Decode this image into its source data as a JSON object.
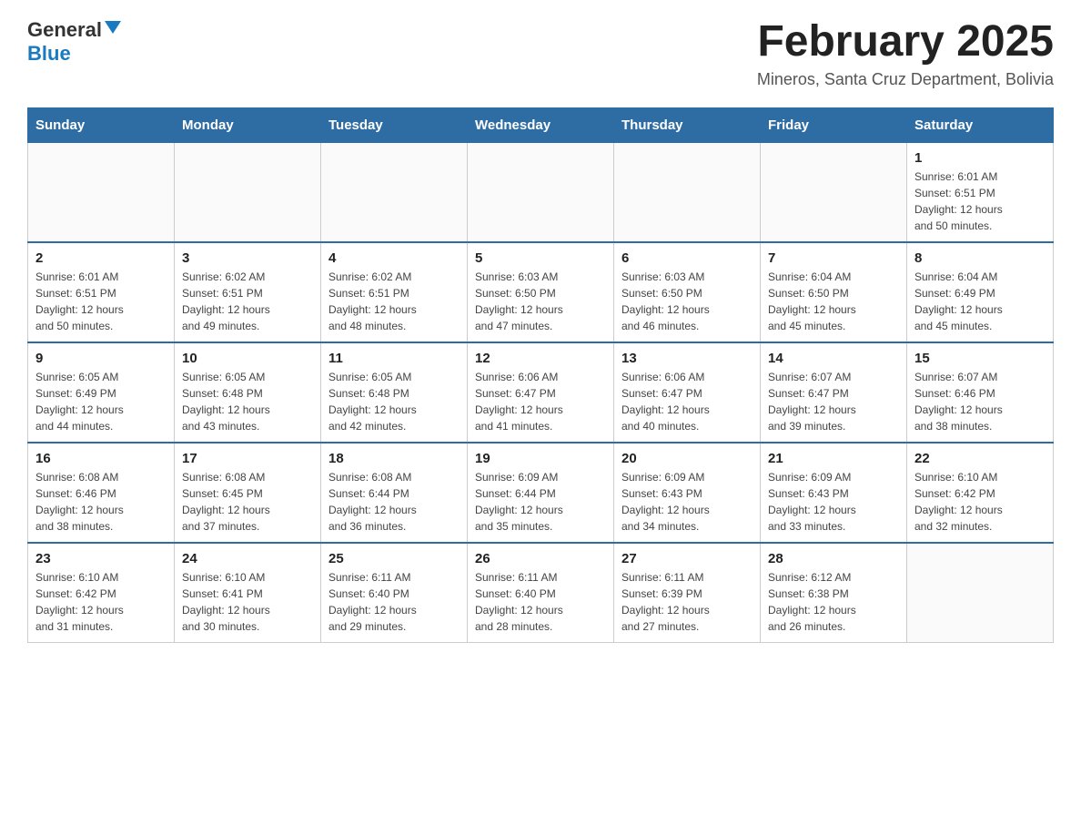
{
  "header": {
    "logo": {
      "general": "General",
      "blue": "Blue",
      "triangle": "▲"
    },
    "title": "February 2025",
    "location": "Mineros, Santa Cruz Department, Bolivia"
  },
  "weekdays": [
    "Sunday",
    "Monday",
    "Tuesday",
    "Wednesday",
    "Thursday",
    "Friday",
    "Saturday"
  ],
  "weeks": [
    [
      {
        "day": "",
        "info": ""
      },
      {
        "day": "",
        "info": ""
      },
      {
        "day": "",
        "info": ""
      },
      {
        "day": "",
        "info": ""
      },
      {
        "day": "",
        "info": ""
      },
      {
        "day": "",
        "info": ""
      },
      {
        "day": "1",
        "info": "Sunrise: 6:01 AM\nSunset: 6:51 PM\nDaylight: 12 hours\nand 50 minutes."
      }
    ],
    [
      {
        "day": "2",
        "info": "Sunrise: 6:01 AM\nSunset: 6:51 PM\nDaylight: 12 hours\nand 50 minutes."
      },
      {
        "day": "3",
        "info": "Sunrise: 6:02 AM\nSunset: 6:51 PM\nDaylight: 12 hours\nand 49 minutes."
      },
      {
        "day": "4",
        "info": "Sunrise: 6:02 AM\nSunset: 6:51 PM\nDaylight: 12 hours\nand 48 minutes."
      },
      {
        "day": "5",
        "info": "Sunrise: 6:03 AM\nSunset: 6:50 PM\nDaylight: 12 hours\nand 47 minutes."
      },
      {
        "day": "6",
        "info": "Sunrise: 6:03 AM\nSunset: 6:50 PM\nDaylight: 12 hours\nand 46 minutes."
      },
      {
        "day": "7",
        "info": "Sunrise: 6:04 AM\nSunset: 6:50 PM\nDaylight: 12 hours\nand 45 minutes."
      },
      {
        "day": "8",
        "info": "Sunrise: 6:04 AM\nSunset: 6:49 PM\nDaylight: 12 hours\nand 45 minutes."
      }
    ],
    [
      {
        "day": "9",
        "info": "Sunrise: 6:05 AM\nSunset: 6:49 PM\nDaylight: 12 hours\nand 44 minutes."
      },
      {
        "day": "10",
        "info": "Sunrise: 6:05 AM\nSunset: 6:48 PM\nDaylight: 12 hours\nand 43 minutes."
      },
      {
        "day": "11",
        "info": "Sunrise: 6:05 AM\nSunset: 6:48 PM\nDaylight: 12 hours\nand 42 minutes."
      },
      {
        "day": "12",
        "info": "Sunrise: 6:06 AM\nSunset: 6:47 PM\nDaylight: 12 hours\nand 41 minutes."
      },
      {
        "day": "13",
        "info": "Sunrise: 6:06 AM\nSunset: 6:47 PM\nDaylight: 12 hours\nand 40 minutes."
      },
      {
        "day": "14",
        "info": "Sunrise: 6:07 AM\nSunset: 6:47 PM\nDaylight: 12 hours\nand 39 minutes."
      },
      {
        "day": "15",
        "info": "Sunrise: 6:07 AM\nSunset: 6:46 PM\nDaylight: 12 hours\nand 38 minutes."
      }
    ],
    [
      {
        "day": "16",
        "info": "Sunrise: 6:08 AM\nSunset: 6:46 PM\nDaylight: 12 hours\nand 38 minutes."
      },
      {
        "day": "17",
        "info": "Sunrise: 6:08 AM\nSunset: 6:45 PM\nDaylight: 12 hours\nand 37 minutes."
      },
      {
        "day": "18",
        "info": "Sunrise: 6:08 AM\nSunset: 6:44 PM\nDaylight: 12 hours\nand 36 minutes."
      },
      {
        "day": "19",
        "info": "Sunrise: 6:09 AM\nSunset: 6:44 PM\nDaylight: 12 hours\nand 35 minutes."
      },
      {
        "day": "20",
        "info": "Sunrise: 6:09 AM\nSunset: 6:43 PM\nDaylight: 12 hours\nand 34 minutes."
      },
      {
        "day": "21",
        "info": "Sunrise: 6:09 AM\nSunset: 6:43 PM\nDaylight: 12 hours\nand 33 minutes."
      },
      {
        "day": "22",
        "info": "Sunrise: 6:10 AM\nSunset: 6:42 PM\nDaylight: 12 hours\nand 32 minutes."
      }
    ],
    [
      {
        "day": "23",
        "info": "Sunrise: 6:10 AM\nSunset: 6:42 PM\nDaylight: 12 hours\nand 31 minutes."
      },
      {
        "day": "24",
        "info": "Sunrise: 6:10 AM\nSunset: 6:41 PM\nDaylight: 12 hours\nand 30 minutes."
      },
      {
        "day": "25",
        "info": "Sunrise: 6:11 AM\nSunset: 6:40 PM\nDaylight: 12 hours\nand 29 minutes."
      },
      {
        "day": "26",
        "info": "Sunrise: 6:11 AM\nSunset: 6:40 PM\nDaylight: 12 hours\nand 28 minutes."
      },
      {
        "day": "27",
        "info": "Sunrise: 6:11 AM\nSunset: 6:39 PM\nDaylight: 12 hours\nand 27 minutes."
      },
      {
        "day": "28",
        "info": "Sunrise: 6:12 AM\nSunset: 6:38 PM\nDaylight: 12 hours\nand 26 minutes."
      },
      {
        "day": "",
        "info": ""
      }
    ]
  ]
}
